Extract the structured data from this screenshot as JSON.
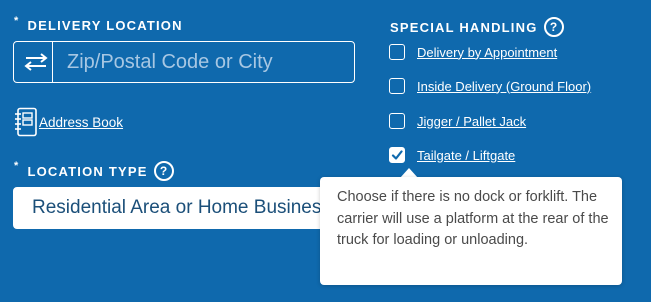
{
  "delivery": {
    "required_mark": "*",
    "label": "DELIVERY LOCATION",
    "zip_placeholder": "Zip/Postal Code or City",
    "zip_value": "",
    "address_book_label": "Address Book"
  },
  "location_type": {
    "required_mark": "*",
    "label": "LOCATION TYPE",
    "help_glyph": "?",
    "selected_value": "Residential Area or Home Business"
  },
  "special_handling": {
    "label": "SPECIAL HANDLING",
    "help_glyph": "?",
    "options": [
      {
        "label": "Delivery by Appointment",
        "checked": false
      },
      {
        "label": "Inside Delivery (Ground Floor)",
        "checked": false
      },
      {
        "label": "Jigger / Pallet Jack",
        "checked": false
      },
      {
        "label": "Tailgate / Liftgate",
        "checked": true
      }
    ]
  },
  "tooltip": {
    "text": "Choose if there is no dock or forklift. The carrier will use a platform at the rear of the truck for loading or unloading."
  },
  "colors": {
    "background": "#0f69ad",
    "select_text": "#1b4f79",
    "tooltip_text": "#4a4a4a"
  },
  "icons": {
    "swap": "swap-arrows-icon",
    "address_book": "address-book-icon",
    "help": "help-icon",
    "checkmark": "checkmark-icon"
  }
}
